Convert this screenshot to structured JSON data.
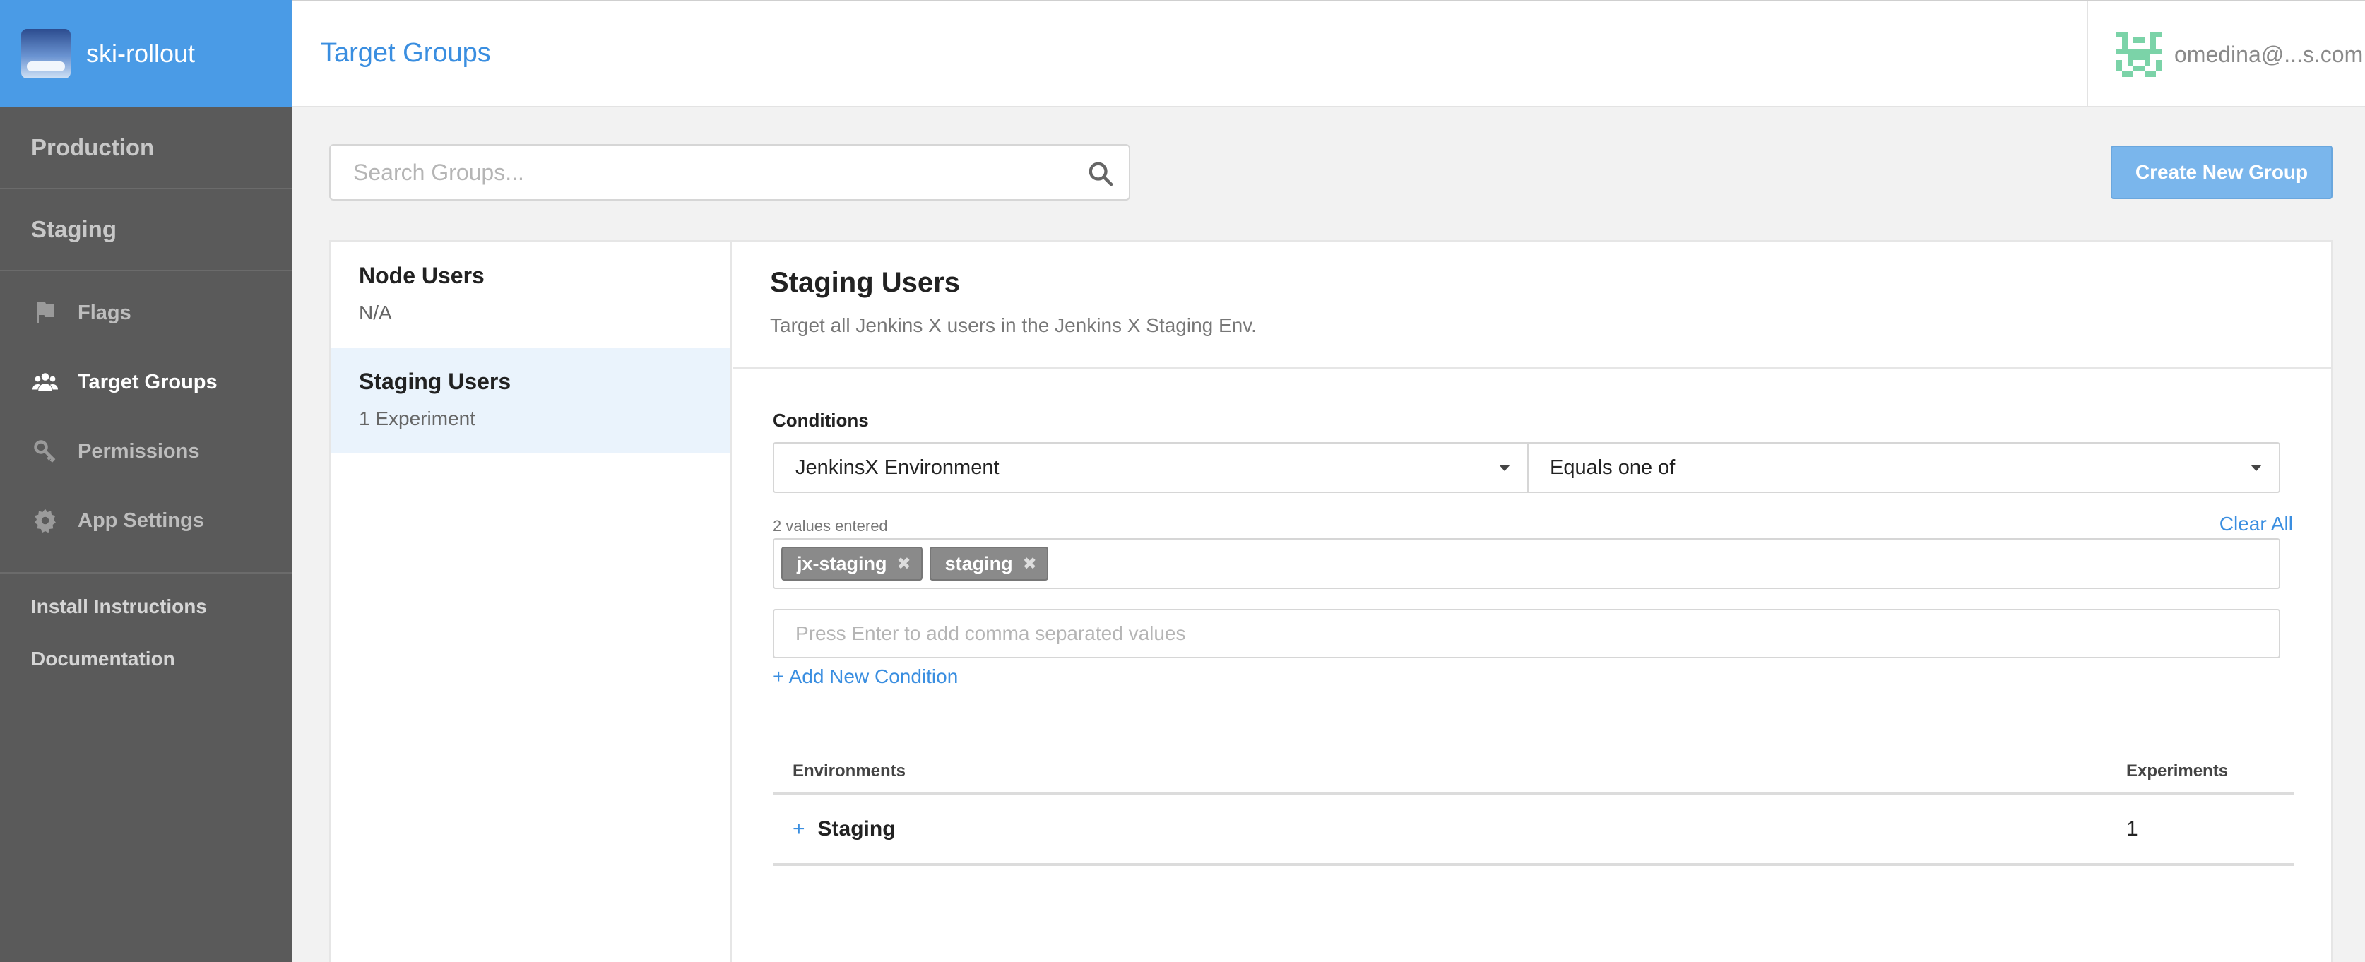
{
  "app": {
    "name": "ski-rollout"
  },
  "sidebar": {
    "environments": [
      {
        "label": "Production"
      },
      {
        "label": "Staging"
      }
    ],
    "nav": [
      {
        "label": "Flags",
        "icon": "flag-icon"
      },
      {
        "label": "Target Groups",
        "icon": "users-icon",
        "active": true
      },
      {
        "label": "Permissions",
        "icon": "key-icon"
      },
      {
        "label": "App Settings",
        "icon": "gear-icon"
      }
    ],
    "links": [
      {
        "label": "Install Instructions"
      },
      {
        "label": "Documentation"
      }
    ]
  },
  "header": {
    "title": "Target Groups",
    "user_email": "omedina@...s.com"
  },
  "search": {
    "placeholder": "Search Groups..."
  },
  "toolbar": {
    "create_label": "Create New Group"
  },
  "groups": [
    {
      "name": "Node Users",
      "sub": "N/A"
    },
    {
      "name": "Staging Users",
      "sub": "1 Experiment",
      "selected": true
    }
  ],
  "detail": {
    "title": "Staging Users",
    "description": "Target all Jenkins X users in the Jenkins X Staging Env.",
    "conditions_label": "Conditions",
    "attribute": "JenkinsX Environment",
    "operator": "Equals one of",
    "values_count": "2 values entered",
    "clear_all": "Clear All",
    "tags": [
      "jx-staging",
      "staging"
    ],
    "tag_remove_glyph": "✖",
    "add_values_placeholder": "Press Enter to add comma separated values",
    "add_condition": "+ Add New Condition"
  },
  "environments_table": {
    "headers": {
      "environments": "Environments",
      "experiments": "Experiments"
    },
    "rows": [
      {
        "expand": "+",
        "name": "Staging",
        "experiments": "1"
      }
    ]
  },
  "colors": {
    "brand": "#4a9be6",
    "sidebar": "#5a5a5a",
    "accent": "#3a8ee0",
    "create_button": "#7ab6ec",
    "selected_row": "#eaf3fc"
  }
}
